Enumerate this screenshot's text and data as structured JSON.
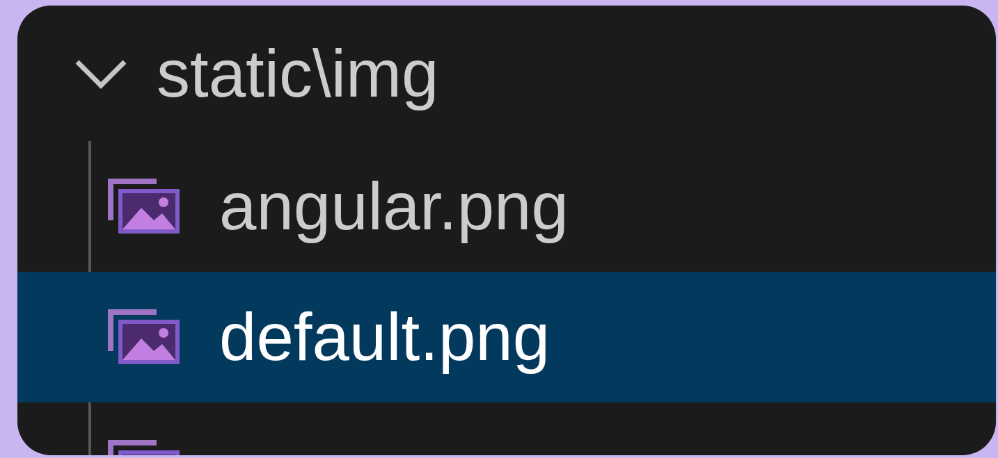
{
  "explorer": {
    "folder": {
      "name": "static\\img",
      "expanded": true,
      "children": [
        {
          "kind": "image",
          "name": "angular.png",
          "selected": false
        },
        {
          "kind": "image",
          "name": "default.png",
          "selected": true
        },
        {
          "kind": "image",
          "selected": false
        }
      ]
    }
  }
}
